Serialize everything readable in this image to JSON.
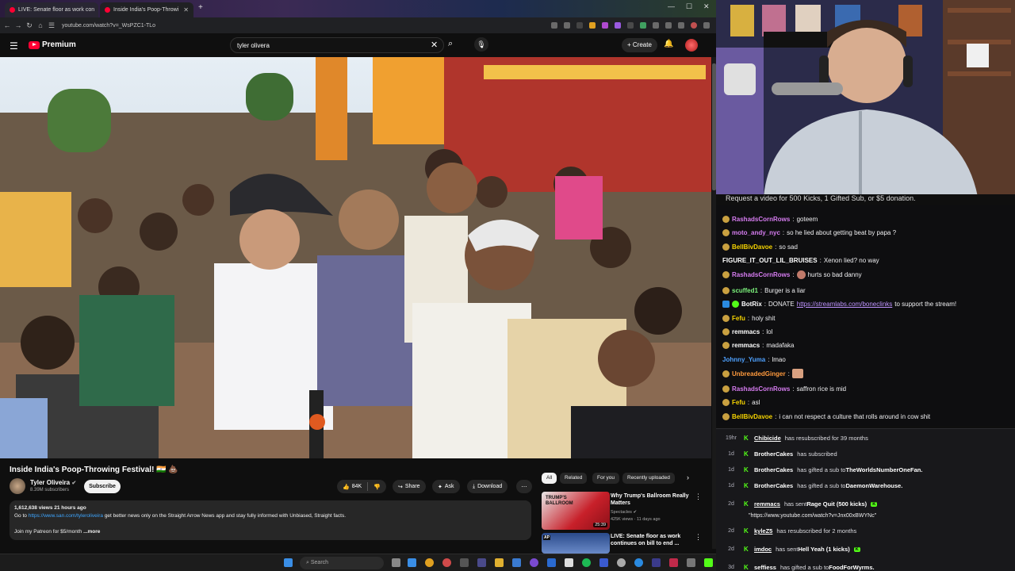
{
  "browser": {
    "tabs": [
      {
        "label": "LIVE: Senate floor as work con"
      },
      {
        "label": "Inside India's Poop-Throwi"
      }
    ],
    "url": "youtube.com/watch?v=_WsPZC1-TLo"
  },
  "youtube": {
    "logo_text": "Premium",
    "search_value": "tyler olivera",
    "create_label": "Create",
    "video": {
      "title": "Inside India's Poop-Throwing Festival! 🇮🇳 💩",
      "channel": "Tyler Oliveira",
      "subscribers": "8.39M subscribers",
      "subscribe_label": "Subscribe",
      "likes": "84K",
      "share_label": "Share",
      "ask_label": "Ask",
      "download_label": "Download",
      "views_line": "1,612,638 views  21 hours ago",
      "desc_prefix": "Go to ",
      "desc_link": "https://www.san.com/tyleroliveira",
      "desc_suffix": " get better news only on the Straight Arrow News app and stay fully informed with Unbiased, Straight facts.",
      "desc_line3": "Join my Patreon for $5/month",
      "desc_more": "...more"
    },
    "chips": [
      "All",
      "Related",
      "For you",
      "Recently uploaded"
    ],
    "related": [
      {
        "title": "Why Trump's Ballroom Really Matters",
        "channel": "Spectacles",
        "meta": "425K views · 11 days ago",
        "duration": "25:39",
        "thumb_text": "TRUMP'S BALLROOM"
      },
      {
        "title": "LIVE: Senate floor as work continues on bill to end ...",
        "channel": "",
        "meta": "",
        "duration": "",
        "thumb_text": "AP"
      }
    ]
  },
  "taskbar": {
    "search_placeholder": "Search"
  },
  "stream": {
    "banner": "Request a video for 500 Kicks, 1 Gifted Sub, or $5 donation.",
    "chat": [
      {
        "user": "RashadsCornRows",
        "color": "#d67cf0",
        "text": "goteem"
      },
      {
        "user": "moto_andy_nyc",
        "color": "#d67cf0",
        "text": "so he lied about getting beat by papa ?"
      },
      {
        "user": "BellBivDavoe",
        "color": "#f5d300",
        "text": "so sad"
      },
      {
        "user": "FIGURE_IT_OUT_LIL_BRUISES",
        "color": "#ffffff",
        "text": "Xenon lied? no way"
      },
      {
        "user": "RashadsCornRows",
        "color": "#d67cf0",
        "text": "hurts so bad danny"
      },
      {
        "user": "scuffed1",
        "color": "#7cf27c",
        "text": "Burger is a liar"
      },
      {
        "user": "BotRix",
        "color": "#ffffff",
        "text": "DONATE ",
        "link": "https://streamlabs.com/boneclinks",
        "tail": " to support the stream!"
      },
      {
        "user": "Fefu",
        "color": "#f5d300",
        "text": "holy shit"
      },
      {
        "user": "remmacs",
        "color": "#ffffff",
        "text": "lol"
      },
      {
        "user": "remmacs",
        "color": "#ffffff",
        "text": "madafaka"
      },
      {
        "user": "Johnny_Yuma",
        "color": "#4ea1ff",
        "text": "lmao"
      },
      {
        "user": "UnbreadedGinger",
        "color": "#ff9a3d",
        "text": ""
      },
      {
        "user": "RashadsCornRows",
        "color": "#d67cf0",
        "text": "saffron rice is mid"
      },
      {
        "user": "Fefu",
        "color": "#f5d300",
        "text": "asl"
      },
      {
        "user": "BellBivDavoe",
        "color": "#f5d300",
        "text": "i can not respect a culture that rolls around in cow shit"
      }
    ],
    "events": [
      {
        "time": "19hr",
        "name": "Chibicide",
        "action": " has resubscribed for 39 months",
        "target": ""
      },
      {
        "time": "1d",
        "name": "BrotherCakes",
        "action": " has subscribed",
        "target": ""
      },
      {
        "time": "1d",
        "name": "BrotherCakes",
        "action": " has gifted a sub to ",
        "target": "TheWorldsNumberOneFan."
      },
      {
        "time": "1d",
        "name": "BrotherCakes",
        "action": " has gifted a sub to ",
        "target": "DaemonWarehouse."
      },
      {
        "time": "2d",
        "name": "remmacs",
        "action": " has sent ",
        "target": "Rage Quit (500 kicks)"
      },
      {
        "time": "2d",
        "name": "kyleZ5",
        "action": " has resubscribed for 2 months",
        "target": ""
      },
      {
        "time": "2d",
        "name": "imdoc",
        "action": " has sent ",
        "target": "Hell Yeah (1 kicks)"
      },
      {
        "time": "3d",
        "name": "seffiess",
        "action": " has gifted a sub to ",
        "target": "FoodForWyrms."
      }
    ],
    "event_note": "\"https://www.youtube.com/watch?v=Jnx00xBWYNc\""
  }
}
